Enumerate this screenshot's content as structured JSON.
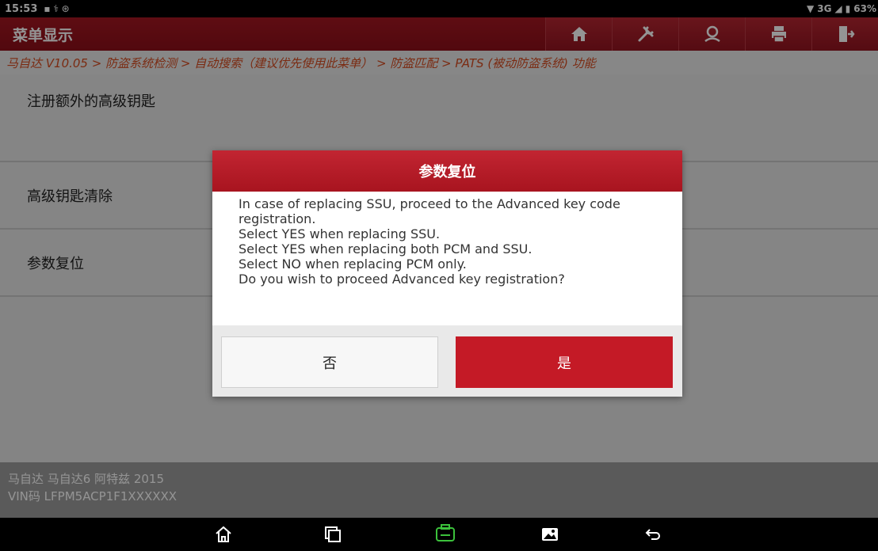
{
  "status_bar": {
    "time": "15:53",
    "network": "3G",
    "battery": "63%"
  },
  "header": {
    "title": "菜单显示",
    "icons": [
      "home-icon",
      "tools-icon",
      "user-icon",
      "print-icon",
      "exit-icon"
    ]
  },
  "breadcrumb": "马自达 V10.05 > 防盗系统检测 > 自动搜索（建议优先使用此菜单） > 防盗匹配 > PATS (被动防盗系统) 功能",
  "menu": {
    "items": [
      {
        "label": "注册额外的高级钥匙"
      },
      {
        "label": "高级钥匙清除"
      },
      {
        "label": "参数复位"
      }
    ]
  },
  "footer": {
    "vehicle": "马自达 马自达6 阿特兹 2015",
    "vin": "VIN码 LFPM5ACP1F1XXXXXX"
  },
  "dialog": {
    "title": "参数复位",
    "lines": [
      "In case of replacing SSU, proceed to the Advanced key code registration.",
      "Select YES when replacing SSU.",
      "Select YES when replacing both PCM and SSU.",
      "Select NO when replacing PCM only.",
      "Do you wish to proceed Advanced key registration?"
    ],
    "no_label": "否",
    "yes_label": "是"
  },
  "navbar": {
    "icons": [
      "home-icon",
      "recents-icon",
      "vci-icon",
      "gallery-icon",
      "back-icon"
    ]
  },
  "colors": {
    "brand_red": "#a31621",
    "breadcrumb_text": "#d44b20",
    "vci_green": "#3cc23c"
  }
}
